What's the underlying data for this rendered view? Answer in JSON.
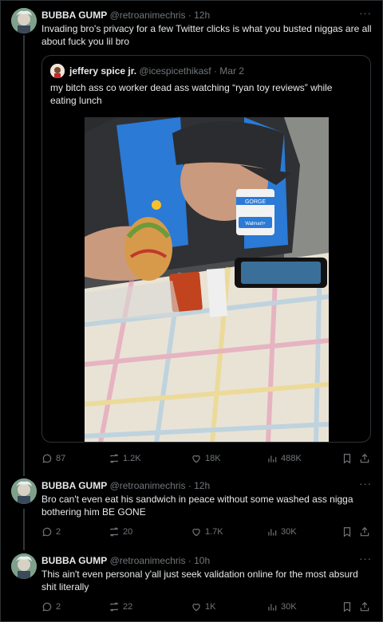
{
  "tweets": [
    {
      "author": "BUBBA GUMP",
      "handle": "@retroanimechris",
      "time": "12h",
      "text": "Invading bro's privacy for a few Twitter clicks is what you busted niggas are all about fuck you lil bro",
      "replies": "87",
      "retweets": "1.2K",
      "likes": "18K",
      "views": "488K"
    },
    {
      "author": "BUBBA GUMP",
      "handle": "@retroanimechris",
      "time": "12h",
      "text": "Bro can't even eat his sandwich in peace without some washed ass nigga bothering him BE GONE",
      "replies": "2",
      "retweets": "20",
      "likes": "1.7K",
      "views": "30K"
    },
    {
      "author": "BUBBA GUMP",
      "handle": "@retroanimechris",
      "time": "10h",
      "text": "This ain't even personal y'all just seek validation online for the most absurd shit literally",
      "replies": "2",
      "retweets": "22",
      "likes": "1K",
      "views": "30K"
    }
  ],
  "quote": {
    "author": "jeffery spice jr.",
    "handle": "@icespicethikasf",
    "date": "Mar 2",
    "text": "my bitch ass co worker dead ass watching “ryan toy reviews” while eating lunch",
    "photo_badge_name": "GORGE",
    "photo_badge_brand": "Walmart+"
  },
  "separator": "·",
  "more_glyph": "···",
  "colors": {
    "background": "#000000",
    "text": "#e7e9ea",
    "muted": "#71767b",
    "border": "#2f3336"
  },
  "icons": [
    "reply-icon",
    "retweet-icon",
    "like-icon",
    "views-icon",
    "bookmark-icon",
    "share-icon"
  ]
}
